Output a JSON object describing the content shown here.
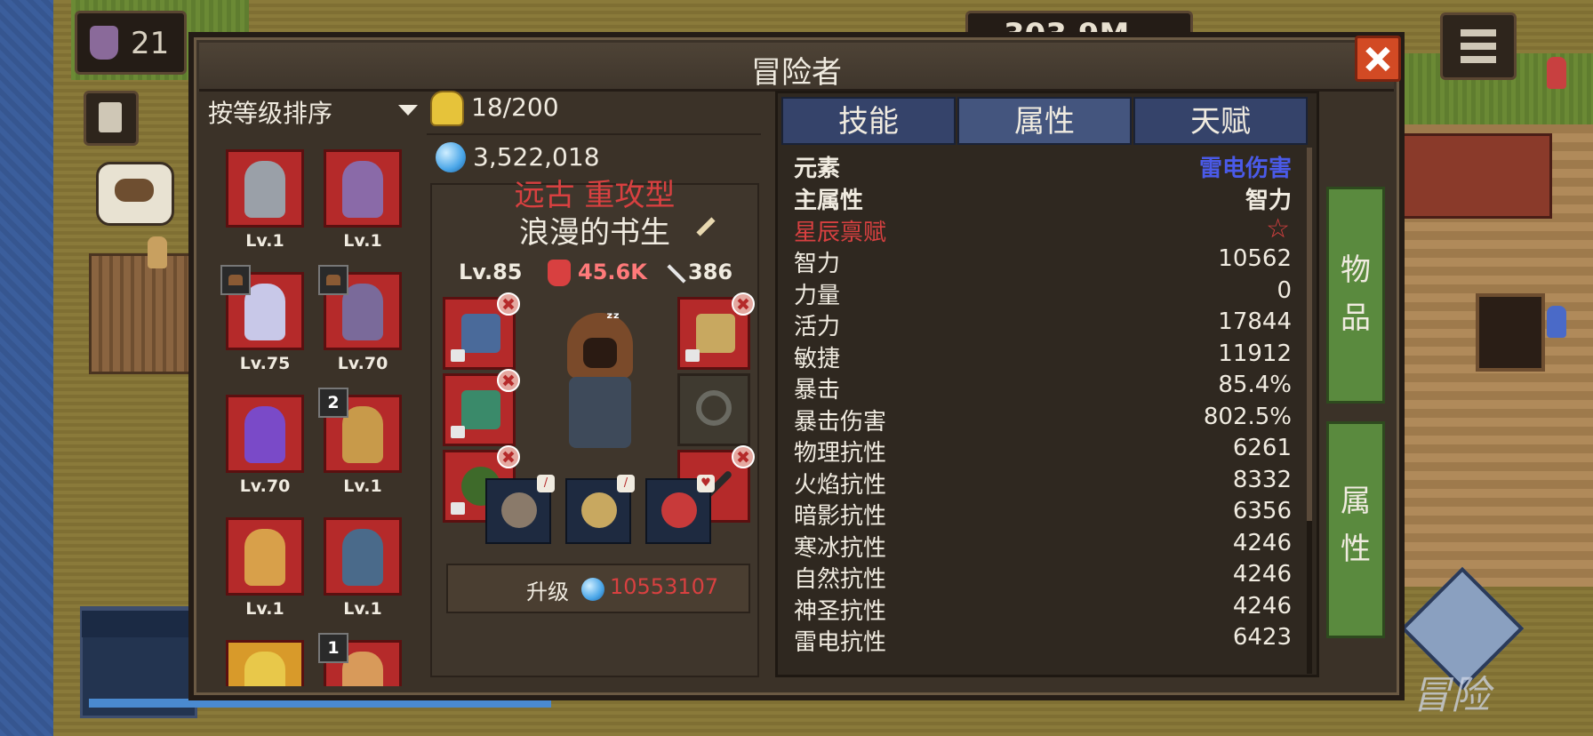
{
  "background": {
    "gold_partial": "21",
    "money_partial": "303.9M",
    "adventure_label": "冒险"
  },
  "panel": {
    "title": "冒险者"
  },
  "hero_list": {
    "sort_label": "按等级排序",
    "heroes": [
      {
        "level": "Lv.1",
        "color": "#9aa0a8",
        "badge": ""
      },
      {
        "level": "Lv.1",
        "color": "#8a6aa8",
        "badge": ""
      },
      {
        "level": "Lv.75",
        "color": "#c8c8e8",
        "badge": "hat"
      },
      {
        "level": "Lv.70",
        "color": "#7a6a9a",
        "badge": "hat"
      },
      {
        "level": "Lv.70",
        "color": "#7a4ac8",
        "badge": ""
      },
      {
        "level": "Lv.1",
        "color": "#c89a4a",
        "badge": "2"
      },
      {
        "level": "Lv.1",
        "color": "#d8a04a",
        "badge": ""
      },
      {
        "level": "Lv.1",
        "color": "#4a6a8a",
        "badge": ""
      },
      {
        "level": "",
        "color": "#e8c84a",
        "badge": ""
      },
      {
        "level": "",
        "color": "#d89a5a",
        "badge": "1"
      }
    ]
  },
  "hero_detail": {
    "roster": "18/200",
    "crystals": "3,522,018",
    "type": "远古 重攻型",
    "name": "浪漫的书生",
    "level": "Lv.85",
    "power": "45.6K",
    "weapon_stat": "386",
    "sleep_mark": "ᶻᶻ",
    "upgrade_label": "升级",
    "upgrade_cost": "10553107",
    "equipment_colors": {
      "staff": "#4a6a9a",
      "robe": "#3a8a6a",
      "wreath": "#3e6a2a",
      "scroll": "#c8a860",
      "wand": "#2a2a2a"
    },
    "skill_colors": [
      "#8a7a6a",
      "#c8a860",
      "#c83a3a"
    ]
  },
  "attributes": {
    "tabs": [
      "技能",
      "属性",
      "天赋"
    ],
    "active_tab": "属性",
    "rows": [
      {
        "name": "元素",
        "value": "雷电伤害"
      },
      {
        "name": "主属性",
        "value": "智力"
      },
      {
        "name": "星辰禀赋",
        "value": ""
      },
      {
        "name": "智力",
        "value": "10562"
      },
      {
        "name": "力量",
        "value": "0"
      },
      {
        "name": "活力",
        "value": "17844"
      },
      {
        "name": "敏捷",
        "value": "11912"
      },
      {
        "name": "暴击",
        "value": "85.4%"
      },
      {
        "name": "暴击伤害",
        "value": "802.5%"
      },
      {
        "name": "物理抗性",
        "value": "6261"
      },
      {
        "name": "火焰抗性",
        "value": "8332"
      },
      {
        "name": "暗影抗性",
        "value": "6356"
      },
      {
        "name": "寒冰抗性",
        "value": "4246"
      },
      {
        "name": "自然抗性",
        "value": "4246"
      },
      {
        "name": "神圣抗性",
        "value": "4246"
      },
      {
        "name": "雷电抗性",
        "value": "6423"
      }
    ]
  },
  "side_buttons": {
    "items": "物品",
    "attributes": "属性"
  }
}
